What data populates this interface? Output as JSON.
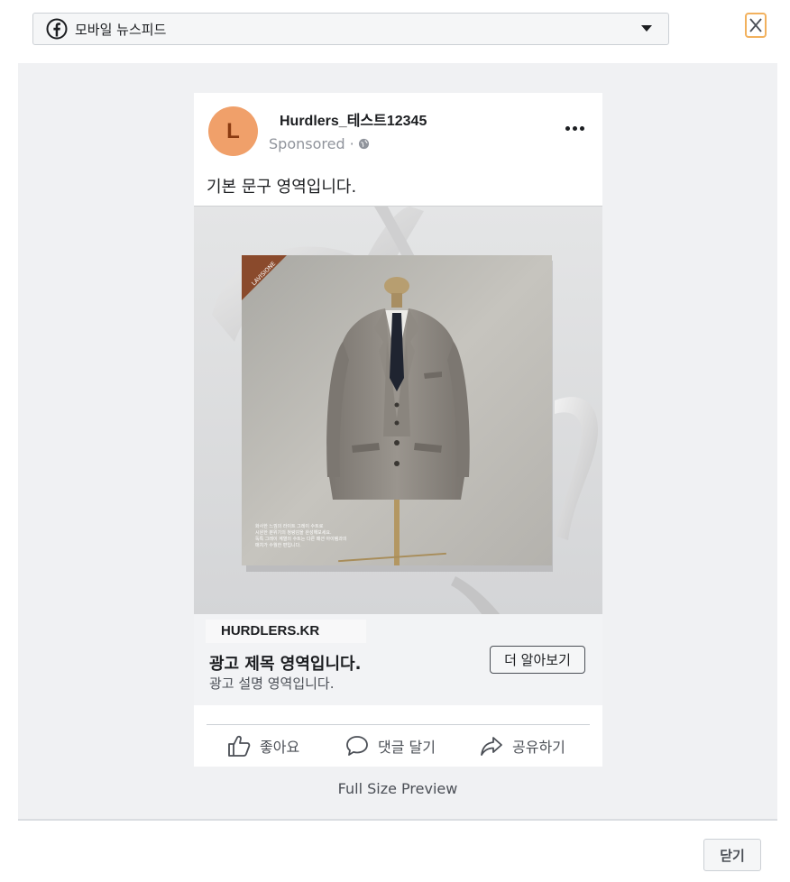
{
  "placement": {
    "icon": "facebook-icon",
    "selected": "모바일 뉴스피드"
  },
  "ad": {
    "page_name": "Hurdlers_테스트12345",
    "avatar_letter": "L",
    "sponsored": "Sponsored · ",
    "primary_text": "기본 문구 영역입니다.",
    "image": {
      "brand_tag": "LAVISIONE",
      "caption_lines": [
        "화사한 느낌의 라이트 그레이 수트로",
        "시원한 분위기의 청량감을 완성해보세요.",
        "독특 그레이 계열의 수트는 다른 패션 아이템과의",
        "매치가 수월한 편입니다."
      ]
    },
    "domain": "HURDLERS.KR",
    "headline": "광고 제목 영역입니다.",
    "description": "광고 설명 영역입니다.",
    "cta": "더 알아보기",
    "actions": {
      "like": "좋아요",
      "comment": "댓글 달기",
      "share": "공유하기"
    }
  },
  "footer": {
    "full_size_preview": "Full Size Preview",
    "close": "닫기"
  },
  "colors": {
    "avatar_bg": "#f0a06a",
    "close_border": "#f2b15d",
    "preview_bg": "#f0f1f3"
  }
}
